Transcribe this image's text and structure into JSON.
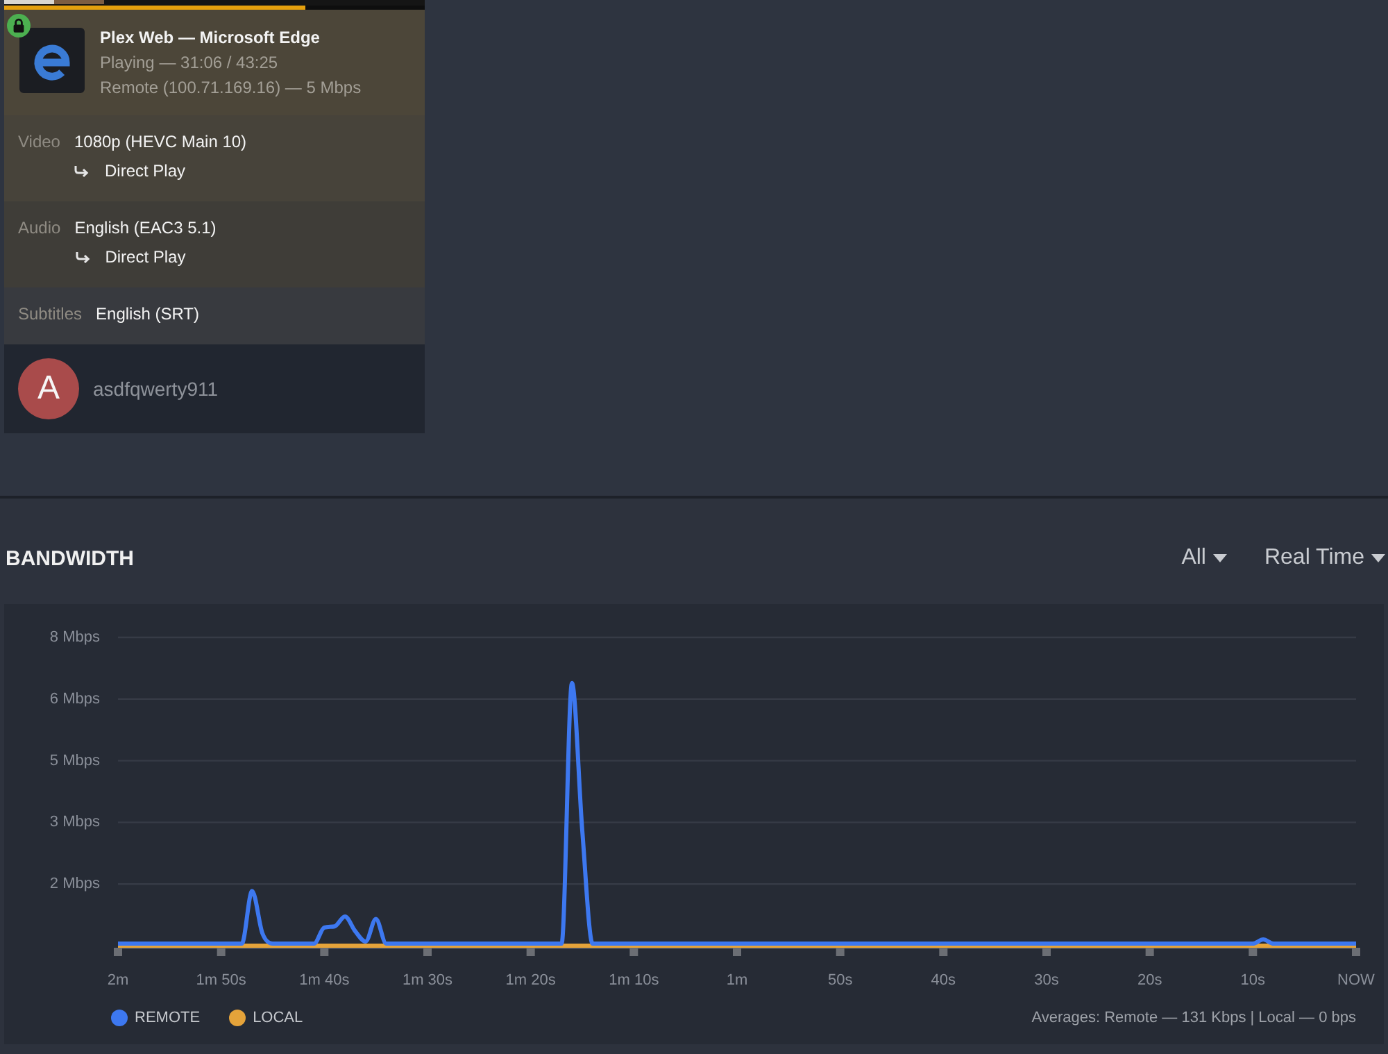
{
  "session": {
    "secure": true,
    "progress": {
      "level": 0.716
    },
    "title": "Plex Web — Microsoft Edge",
    "status": "Playing — 31:06 / 43:25",
    "connection": "Remote (100.71.169.16) — 5 Mbps",
    "streams": [
      {
        "label": "Video",
        "value": "1080p (HEVC Main 10)",
        "decision": "Direct Play"
      },
      {
        "label": "Audio",
        "value": "English (EAC3 5.1)",
        "decision": "Direct Play"
      },
      {
        "label": "Subtitles",
        "value": "English (SRT)"
      }
    ],
    "user": {
      "initial": "A",
      "name": "asdfqwerty911"
    }
  },
  "bandwidth": {
    "title": "BANDWIDTH",
    "filters": [
      "All",
      "Real Time"
    ],
    "chart_data": {
      "type": "line",
      "categories": [
        "2m",
        null,
        null,
        null,
        null,
        null,
        null,
        null,
        null,
        null,
        "1m 50s",
        null,
        null,
        null,
        null,
        null,
        null,
        null,
        null,
        null,
        "1m 40s",
        null,
        null,
        null,
        null,
        null,
        null,
        null,
        null,
        null,
        "1m 30s",
        null,
        null,
        null,
        null,
        null,
        null,
        null,
        null,
        null,
        "1m 20s",
        null,
        null,
        null,
        null,
        null,
        null,
        null,
        null,
        null,
        "1m 10s",
        null,
        null,
        null,
        null,
        null,
        null,
        null,
        null,
        null,
        "1m",
        null,
        null,
        null,
        null,
        null,
        null,
        null,
        null,
        null,
        "50s",
        null,
        null,
        null,
        null,
        null,
        null,
        null,
        null,
        null,
        "40s",
        null,
        null,
        null,
        null,
        null,
        null,
        null,
        null,
        null,
        "30s",
        null,
        null,
        null,
        null,
        null,
        null,
        null,
        null,
        null,
        "20s",
        null,
        null,
        null,
        null,
        null,
        null,
        null,
        null,
        null,
        "10s",
        null,
        null,
        null,
        null,
        null,
        null,
        null,
        null,
        null,
        "NOW"
      ],
      "ylim": [
        0,
        7.5
      ],
      "yticks": [
        {
          "value": 1.5,
          "label": "2 Mbps"
        },
        {
          "value": 3,
          "label": "3 Mbps"
        },
        {
          "value": 4.5,
          "label": "5 Mbps"
        },
        {
          "value": 6,
          "label": "6 Mbps"
        },
        {
          "value": 7.5,
          "label": "8 Mbps"
        }
      ],
      "grid": "y",
      "legend": "bottom",
      "series": [
        {
          "name": "REMOTE",
          "color": "#3d78f0",
          "values": [
            0.05,
            0.05,
            0.05,
            0.05,
            0.05,
            0.05,
            0.05,
            0.05,
            0.05,
            0.05,
            0.05,
            0.05,
            0.05,
            1.33,
            0.3,
            0.05,
            0.05,
            0.05,
            0.05,
            0.05,
            0.44,
            0.47,
            0.71,
            0.35,
            0.1,
            0.65,
            0.05,
            0.05,
            0.05,
            0.05,
            0.05,
            0.05,
            0.05,
            0.05,
            0.05,
            0.05,
            0.05,
            0.05,
            0.05,
            0.05,
            0.05,
            0.05,
            0.05,
            0.05,
            6.39,
            2.8,
            0.05,
            0.05,
            0.05,
            0.05,
            0.05,
            0.05,
            0.05,
            0.05,
            0.05,
            0.05,
            0.05,
            0.05,
            0.05,
            0.05,
            0.05,
            0.05,
            0.05,
            0.05,
            0.05,
            0.05,
            0.05,
            0.05,
            0.05,
            0.05,
            0.05,
            0.05,
            0.05,
            0.05,
            0.05,
            0.05,
            0.05,
            0.05,
            0.05,
            0.05,
            0.05,
            0.05,
            0.05,
            0.05,
            0.05,
            0.05,
            0.05,
            0.05,
            0.05,
            0.05,
            0.05,
            0.05,
            0.05,
            0.05,
            0.05,
            0.05,
            0.05,
            0.05,
            0.05,
            0.05,
            0.05,
            0.05,
            0.05,
            0.05,
            0.05,
            0.05,
            0.05,
            0.05,
            0.05,
            0.05,
            0.05,
            0.15,
            0.05,
            0.05,
            0.05,
            0.05,
            0.05,
            0.05,
            0.05,
            0.05,
            0.05
          ]
        },
        {
          "name": "LOCAL",
          "color": "#e5a33a",
          "values": [
            0,
            0,
            0,
            0,
            0,
            0,
            0,
            0,
            0,
            0,
            0,
            0,
            0,
            0,
            0,
            0,
            0,
            0,
            0,
            0,
            0,
            0,
            0,
            0,
            0,
            0,
            0,
            0,
            0,
            0,
            0,
            0,
            0,
            0,
            0,
            0,
            0,
            0,
            0,
            0,
            0,
            0,
            0,
            0,
            0,
            0,
            0,
            0,
            0,
            0,
            0,
            0,
            0,
            0,
            0,
            0,
            0,
            0,
            0,
            0,
            0,
            0,
            0,
            0,
            0,
            0,
            0,
            0,
            0,
            0,
            0,
            0,
            0,
            0,
            0,
            0,
            0,
            0,
            0,
            0,
            0,
            0,
            0,
            0,
            0,
            0,
            0,
            0,
            0,
            0,
            0,
            0,
            0,
            0,
            0,
            0,
            0,
            0,
            0,
            0,
            0,
            0,
            0,
            0,
            0,
            0,
            0,
            0,
            0,
            0,
            0,
            0,
            0,
            0,
            0,
            0,
            0,
            0,
            0,
            0,
            0
          ]
        }
      ]
    },
    "averages": "Averages: Remote — 131 Kbps | Local — 0 bps"
  }
}
